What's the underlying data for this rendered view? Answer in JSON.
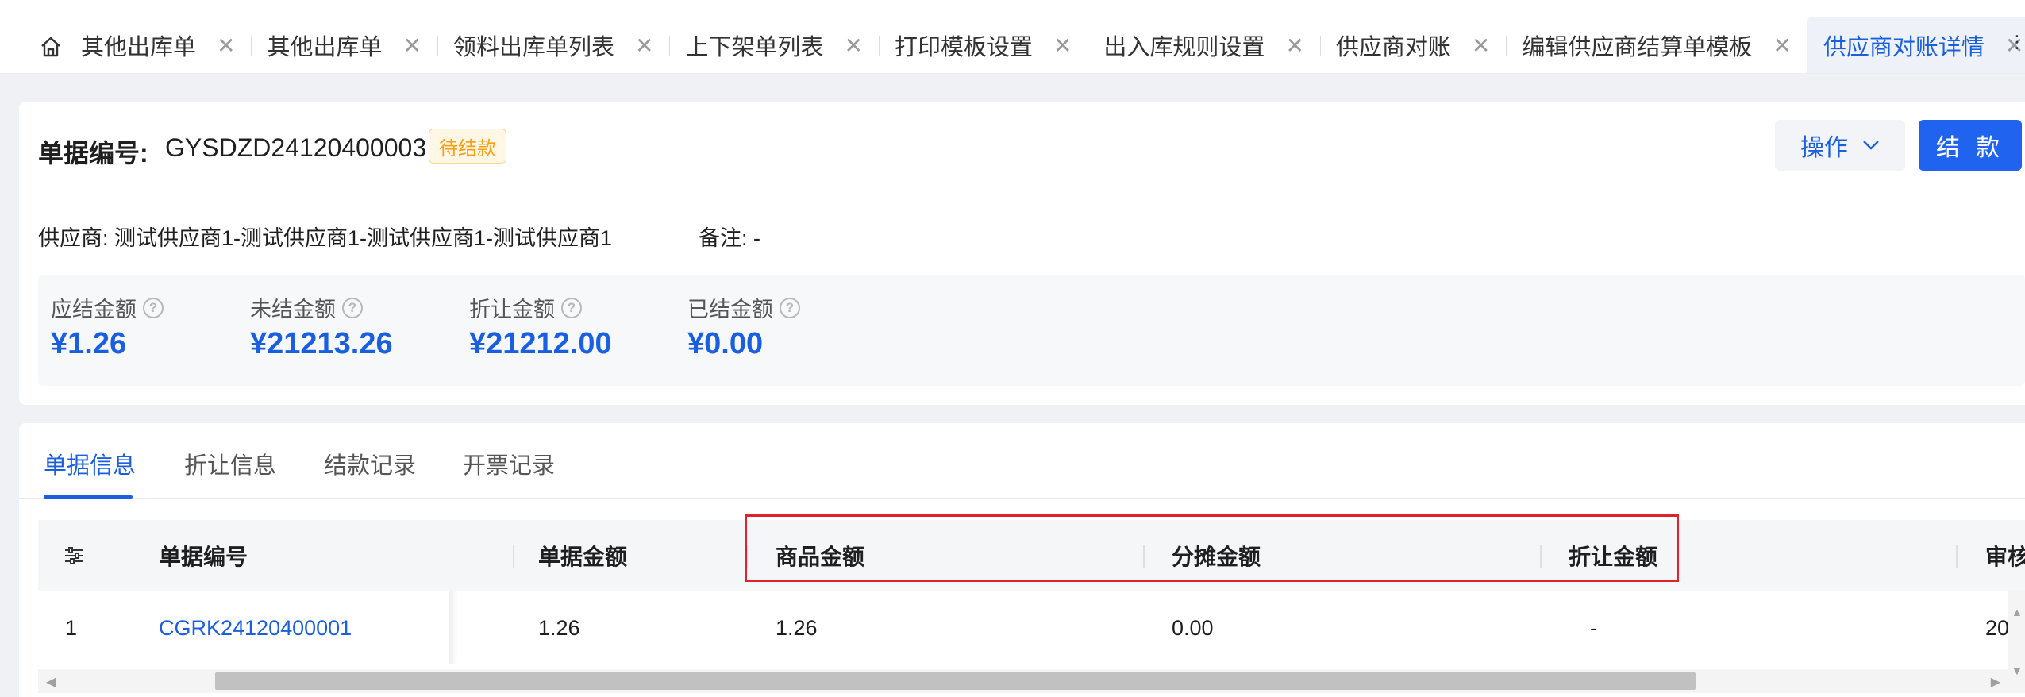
{
  "tabbar": {
    "tabs": [
      {
        "label": "其他出库单",
        "partial": true
      },
      {
        "label": "其他出库单"
      },
      {
        "label": "领料出库单列表"
      },
      {
        "label": "上下架单列表"
      },
      {
        "label": "打印模板设置"
      },
      {
        "label": "出入库规则设置"
      },
      {
        "label": "供应商对账"
      },
      {
        "label": "编辑供应商结算单模板"
      },
      {
        "label": "供应商对账详情",
        "active": true
      }
    ],
    "close_glyph": "✕",
    "more_glyph": "⋮"
  },
  "header": {
    "doc_label": "单据编号:",
    "doc_no": "GYSDZD24120400003",
    "status": "待结款",
    "ops_button": "操作",
    "pay_button": "结 款",
    "supplier": "供应商: 测试供应商1-测试供应商1-测试供应商1-测试供应商1",
    "remark": "备注: -"
  },
  "stats": [
    {
      "label": "应结金额",
      "value": "¥1.26"
    },
    {
      "label": "未结金额",
      "value": "¥21213.26"
    },
    {
      "label": "折让金额",
      "value": "¥21212.00"
    },
    {
      "label": "已结金额",
      "value": "¥0.00"
    }
  ],
  "detail_tabs": [
    {
      "label": "单据信息",
      "active": true
    },
    {
      "label": "折让信息"
    },
    {
      "label": "结款记录"
    },
    {
      "label": "开票记录"
    }
  ],
  "table": {
    "columns": [
      "单据编号",
      "单据金额",
      "商品金额",
      "分摊金额",
      "折让金额",
      "审核时间"
    ],
    "rows": [
      {
        "index": "1",
        "doc_no": "CGRK24120400001",
        "doc_amount": "1.26",
        "goods_amount": "1.26",
        "alloc_amount": "0.00",
        "discount_amount": "-",
        "audit_time": "20"
      }
    ]
  },
  "colors": {
    "accent": "#1a5fe0",
    "primary_button": "#1f63ef",
    "status_text": "#fa9f14",
    "highlight": "#e0202a"
  },
  "icons": {
    "home": "home-icon",
    "close": "close-icon",
    "chevron": "chevron-down-icon",
    "help": "question-circle-icon",
    "settings": "column-settings-icon"
  }
}
